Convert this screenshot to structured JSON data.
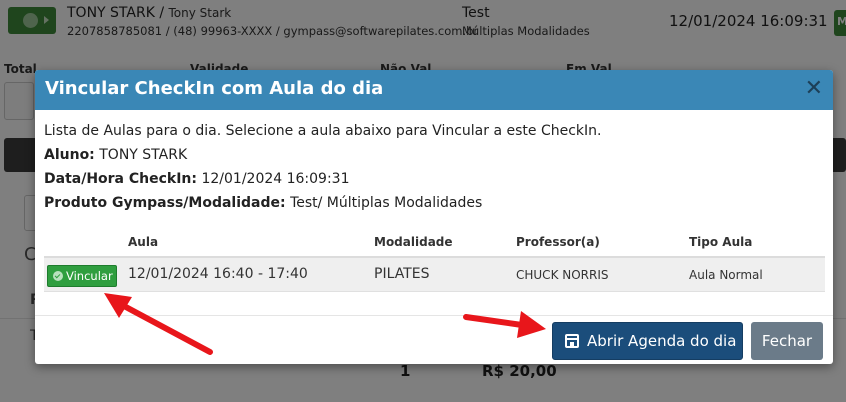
{
  "background": {
    "student_name": "TONY STARK",
    "student_alt_name": "Tony Stark",
    "contact": "2207858785081 / (48) 99963-XXXX / gympass@softwarepilates.com.br",
    "product": "Test",
    "product_modality": "Múltiplas Modalidades",
    "checkin_datetime": "12/01/2024 16:09:31",
    "col_total": "Total",
    "col_validade": "Validade",
    "col_nao_val": "Não Val",
    "col_em_val": "Em Val",
    "letter_c": "C",
    "letter_r": "R",
    "letter_t": "T",
    "quantity": "1",
    "price": "R$ 20,00",
    "colors": {
      "header_green": "#3f8a3b"
    }
  },
  "modal": {
    "title": "Vincular CheckIn com Aula do dia",
    "instruction": "Lista de Aulas para o dia. Selecione a aula abaixo para Vincular a este CheckIn.",
    "aluno_label": "Aluno:",
    "aluno_value": "TONY STARK",
    "checkin_label": "Data/Hora CheckIn:",
    "checkin_value": "12/01/2024 16:09:31",
    "produto_label": "Produto Gympass/Modalidade:",
    "produto_value": "Test/ Múltiplas Modalidades",
    "table": {
      "headers": {
        "aula": "Aula",
        "modalidade": "Modalidade",
        "professor": "Professor(a)",
        "tipo": "Tipo Aula"
      },
      "rows": [
        {
          "action": "Vincular",
          "aula": "12/01/2024 16:40 - 17:40",
          "modalidade": "PILATES",
          "professor": "CHUCK NORRIS",
          "tipo": "Aula Normal"
        }
      ]
    },
    "buttons": {
      "agenda": "Abrir Agenda do dia",
      "fechar": "Fechar"
    },
    "colors": {
      "header": "#3a87b6",
      "vincular": "#2f9e3f",
      "agenda": "#1b4d7b",
      "fechar": "#6b7b89",
      "annotation_arrow": "#e8161b"
    }
  }
}
